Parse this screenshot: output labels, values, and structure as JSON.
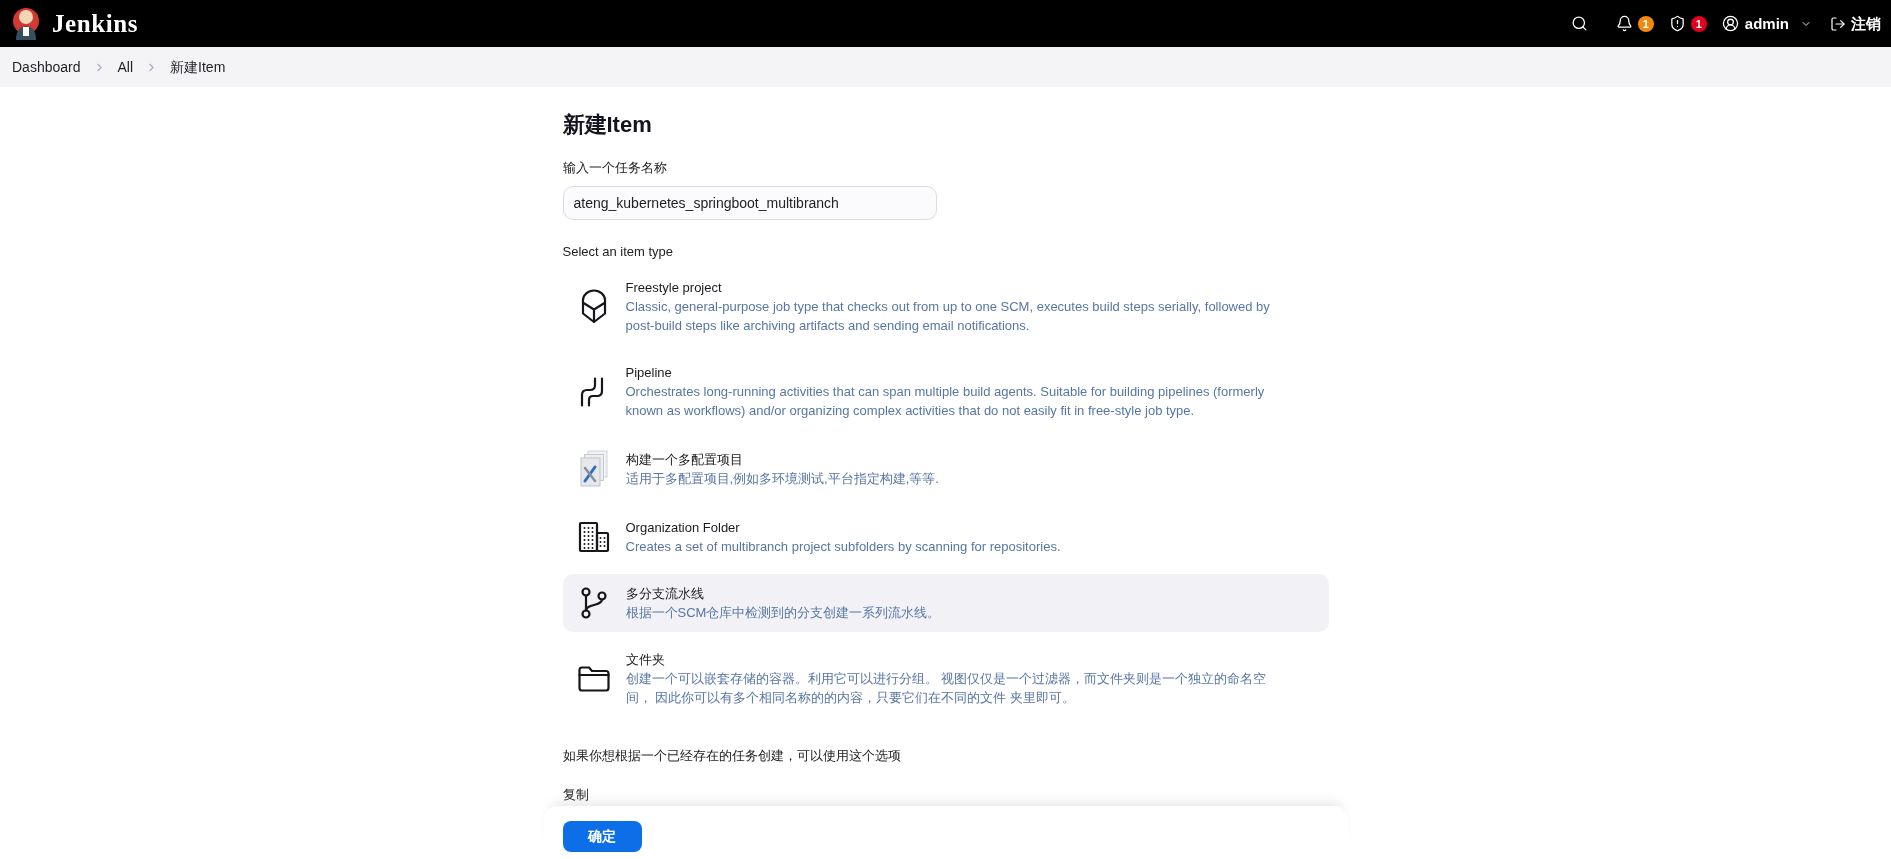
{
  "header": {
    "brand": "Jenkins",
    "alerts": [
      {
        "kind": "notifications",
        "count": "1",
        "color": "#f38a10"
      },
      {
        "kind": "security",
        "count": "1",
        "color": "#e2001f"
      }
    ],
    "user": "admin",
    "logout": "注销"
  },
  "breadcrumbs": [
    {
      "label": "Dashboard"
    },
    {
      "label": "All"
    },
    {
      "label": "新建Item"
    }
  ],
  "page": {
    "title": "新建Item",
    "name_label": "输入一个任务名称",
    "name_value": "ateng_kubernetes_springboot_multibranch",
    "type_heading": "Select an item type"
  },
  "item_types": [
    {
      "kind": "freestyle",
      "name": "Freestyle project",
      "description": "Classic, general-purpose job type that checks out from up to one SCM, executes build steps serially, followed by post-build steps like archiving artifacts and sending email notifications.",
      "selected": false
    },
    {
      "kind": "pipeline",
      "name": "Pipeline",
      "description": "Orchestrates long-running activities that can span multiple build agents. Suitable for building pipelines (formerly known as workflows) and/or organizing complex activities that do not easily fit in free-style job type.",
      "selected": false
    },
    {
      "kind": "matrix",
      "name": "构建一个多配置项目",
      "description": "适用于多配置项目,例如多环境测试,平台指定构建,等等.",
      "selected": false
    },
    {
      "kind": "organization",
      "name": "Organization Folder",
      "description": "Creates a set of multibranch project subfolders by scanning for repositories.",
      "selected": false
    },
    {
      "kind": "multibranch",
      "name": "多分支流水线",
      "description": "根据一个SCM仓库中检测到的分支创建一系列流水线。",
      "selected": true
    },
    {
      "kind": "folder",
      "name": "文件夹",
      "description": "创建一个可以嵌套存储的容器。利用它可以进行分组。 视图仅仅是一个过滤器，而文件夹则是一个独立的命名空间， 因此你可以有多个相同名称的的内容，只要它们在不同的文件 夹里即可。",
      "selected": false
    }
  ],
  "copy": {
    "hint": "如果你想根据一个已经存在的任务创建，可以使用这个选项",
    "label": "复制"
  },
  "submit": "确定"
}
